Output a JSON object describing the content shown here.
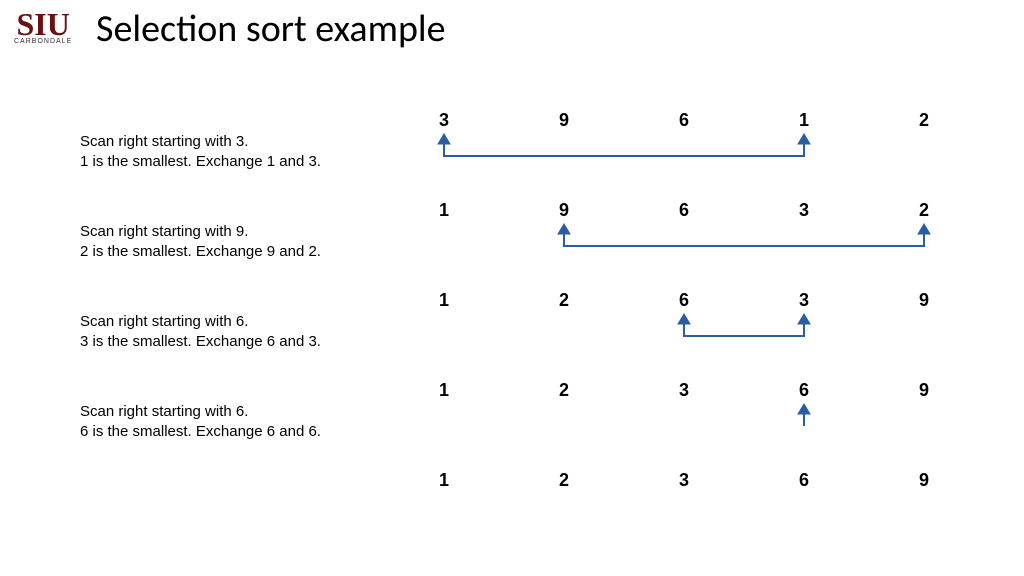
{
  "logo": {
    "text": "SIU",
    "subtext": "CARBONDALE"
  },
  "title": "Selection sort example",
  "steps": [
    {
      "desc_line1": "Scan right starting with 3.",
      "desc_line2": "1 is the smallest. Exchange 1 and 3.",
      "nums": [
        "3",
        "9",
        "6",
        "1",
        "2"
      ],
      "swap": {
        "from_col": 1,
        "to_col": 4
      }
    },
    {
      "desc_line1": "Scan right starting with 9.",
      "desc_line2": "2 is the smallest. Exchange 9 and 2.",
      "nums": [
        "1",
        "9",
        "6",
        "3",
        "2"
      ],
      "swap": {
        "from_col": 2,
        "to_col": 5
      }
    },
    {
      "desc_line1": "Scan right starting with 6.",
      "desc_line2": "3 is the smallest. Exchange 6 and 3.",
      "nums": [
        "1",
        "2",
        "6",
        "3",
        "9"
      ],
      "swap": {
        "from_col": 3,
        "to_col": 4
      }
    },
    {
      "desc_line1": "Scan right starting with 6.",
      "desc_line2": "6 is the smallest. Exchange 6 and 6.",
      "nums": [
        "1",
        "2",
        "3",
        "6",
        "9"
      ],
      "swap": {
        "from_col": 4,
        "to_col": 4
      }
    }
  ],
  "final": [
    "1",
    "2",
    "3",
    "6",
    "9"
  ],
  "colors": {
    "arrow": "#2b5da1",
    "logo": "#6b0f0f"
  }
}
